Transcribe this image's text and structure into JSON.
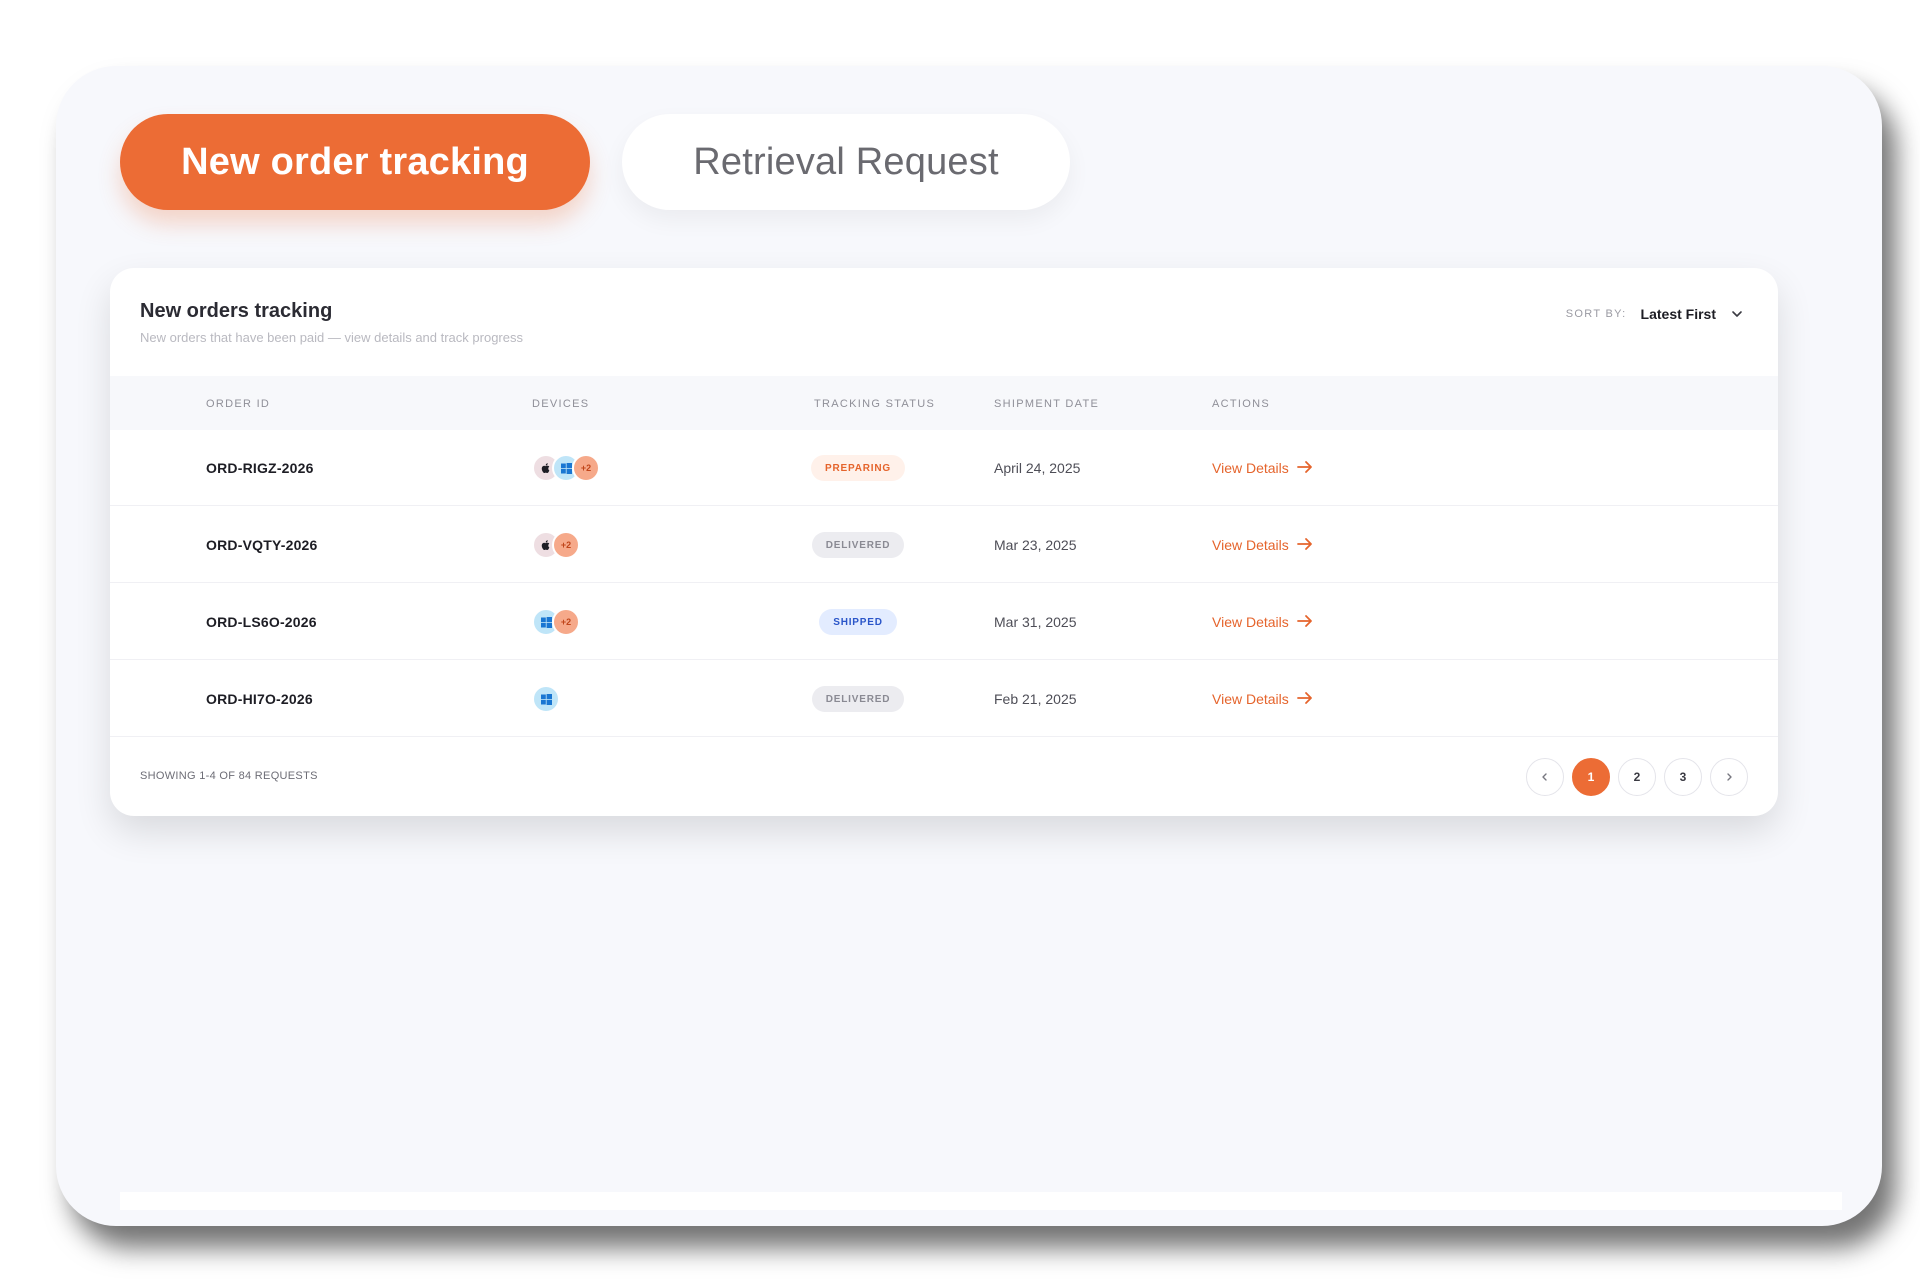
{
  "tabs": {
    "active": "New order tracking",
    "inactive": "Retrieval Request"
  },
  "card": {
    "title": "New orders tracking",
    "subtitle": "New orders that have been paid — view details and track progress",
    "sort_label": "SORT BY:",
    "sort_value": "Latest First"
  },
  "table": {
    "headers": [
      "ORDER ID",
      "DEVICES",
      "TRACKING STATUS",
      "SHIPMENT DATE",
      "ACTIONS"
    ],
    "rows": [
      {
        "order_id": "ORD-RIGZ-2026",
        "devices": [
          "apple-icon",
          "windows-icon"
        ],
        "extra_devices": "+2",
        "status": "PREPARING",
        "status_style": "preparing",
        "date": "April 24, 2025",
        "action": "View Details"
      },
      {
        "order_id": "ORD-VQTY-2026",
        "devices": [
          "apple-icon"
        ],
        "extra_devices": "+2",
        "status": "DELIVERED",
        "status_style": "delivered",
        "date": "Mar 23, 2025",
        "action": "View Details"
      },
      {
        "order_id": "ORD-LS6O-2026",
        "devices": [
          "windows-icon"
        ],
        "extra_devices": "+2",
        "status": "SHIPPED",
        "status_style": "shipped",
        "date": "Mar 31, 2025",
        "action": "View Details"
      },
      {
        "order_id": "ORD-HI7O-2026",
        "devices": [
          "windows-icon"
        ],
        "extra_devices": "",
        "status": "DELIVERED",
        "status_style": "delivered",
        "date": "Feb 21, 2025",
        "action": "View Details"
      }
    ]
  },
  "status_colors": {
    "preparing": {
      "bg": "#fff1ea",
      "fg": "#e5642c"
    },
    "delivered": {
      "bg": "#ececf0",
      "fg": "#8a8a93"
    },
    "shipped": {
      "bg": "#e3ecff",
      "fg": "#2a55c9"
    }
  },
  "footer": {
    "showing": "SHOWING 1-4 OF 84 REQUESTS",
    "pages": [
      "1",
      "2",
      "3"
    ],
    "current_page": "1",
    "prev_icon": "chevron-left-icon",
    "next_icon": "chevron-right-icon"
  },
  "colors": {
    "accent": "#ec6c35",
    "frame_bg": "#f7f8fc"
  }
}
